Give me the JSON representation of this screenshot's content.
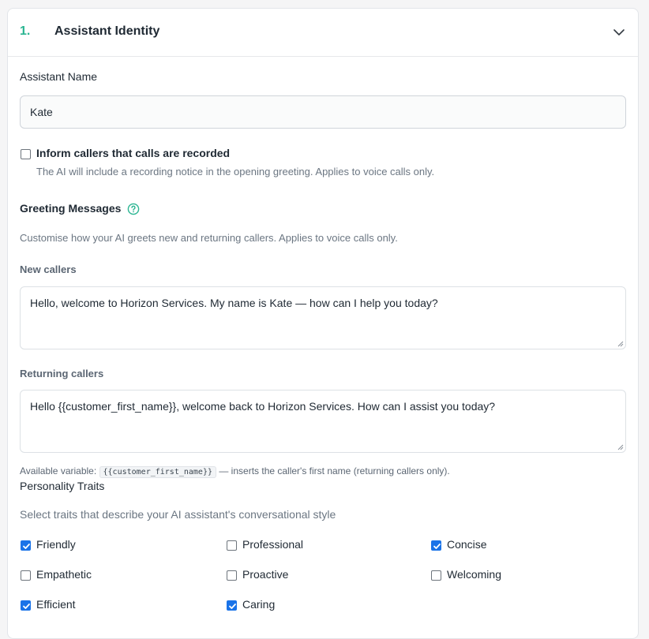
{
  "section": {
    "number": "1.",
    "title": "Assistant Identity"
  },
  "assistant_name": {
    "label": "Assistant Name",
    "value": "Kate"
  },
  "recording": {
    "label": "Inform callers that calls are recorded",
    "checked": false,
    "help": "The AI will include a recording notice in the opening greeting. Applies to voice calls only."
  },
  "greetings": {
    "title": "Greeting Messages",
    "help": "Customise how your AI greets new and returning callers. Applies to voice calls only.",
    "new_label": "New callers",
    "new_value": "Hello, welcome to Horizon Services. My name is Kate — how can I help you today?",
    "returning_label": "Returning callers",
    "returning_value": "Hello {{customer_first_name}}, welcome back to Horizon Services. How can I assist you today?",
    "variable_prefix": "Available variable:",
    "variable_code": "{{customer_first_name}}",
    "variable_suffix": "— inserts the caller's first name (returning callers only)."
  },
  "personality": {
    "title": "Personality Traits",
    "help": "Select traits that describe your AI assistant's conversational style",
    "traits": [
      {
        "label": "Friendly",
        "checked": true
      },
      {
        "label": "Professional",
        "checked": false
      },
      {
        "label": "Concise",
        "checked": true
      },
      {
        "label": "Empathetic",
        "checked": false
      },
      {
        "label": "Proactive",
        "checked": false
      },
      {
        "label": "Welcoming",
        "checked": false
      },
      {
        "label": "Efficient",
        "checked": true
      },
      {
        "label": "Caring",
        "checked": true
      }
    ]
  },
  "colors": {
    "accent": "#2bb592",
    "checkbox_on": "#1a73e8"
  }
}
